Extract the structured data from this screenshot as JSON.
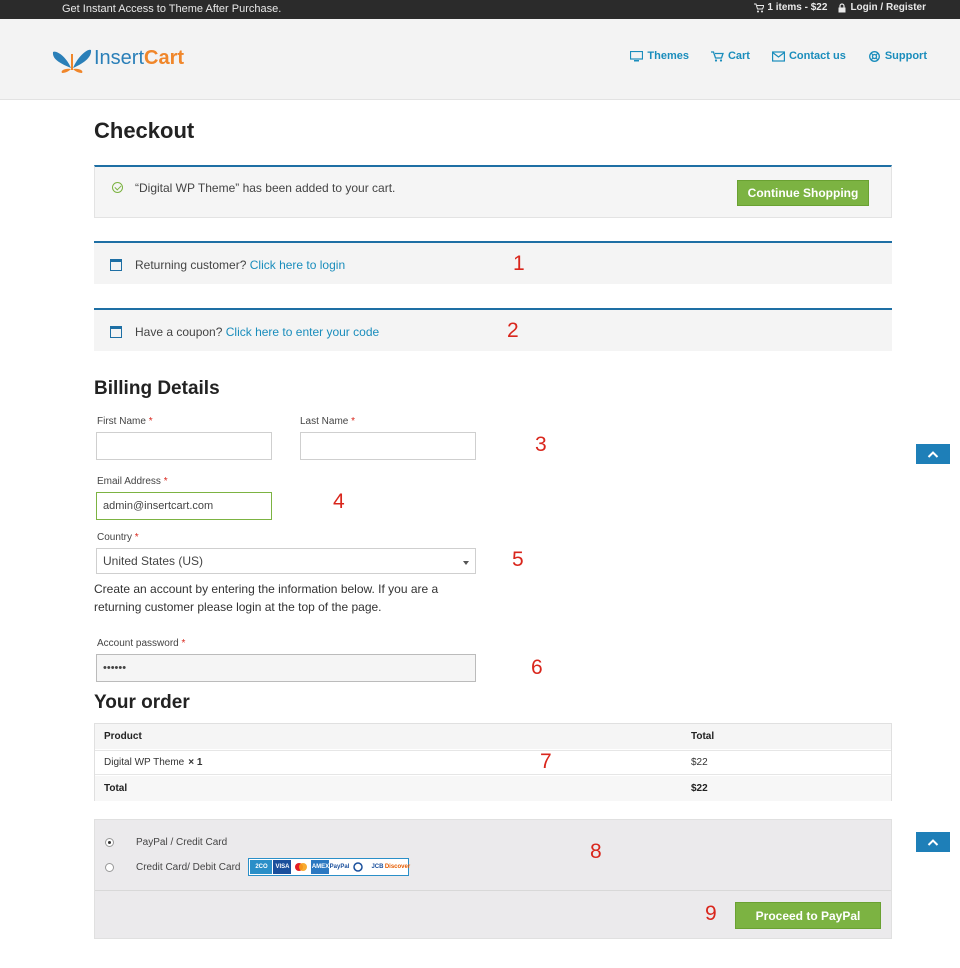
{
  "topbar": {
    "promo": "Get Instant Access to Theme After Purchase.",
    "cart_summary": "1 items - $22",
    "login_register": "Login / Register"
  },
  "brand": {
    "part1": "Insert",
    "part2": "Cart"
  },
  "nav": [
    {
      "label": "Themes",
      "icon": "monitor-icon"
    },
    {
      "label": "Cart",
      "icon": "cart-icon"
    },
    {
      "label": "Contact us",
      "icon": "envelope-icon"
    },
    {
      "label": "Support",
      "icon": "lifebuoy-icon"
    }
  ],
  "page_title": "Checkout",
  "cart_notice": {
    "message": "“Digital WP Theme” has been added to your cart.",
    "button": "Continue Shopping"
  },
  "login_notice": {
    "text": "Returning customer?",
    "link": "Click here to login"
  },
  "coupon_notice": {
    "text": "Have a coupon?",
    "link": "Click here to enter your code"
  },
  "billing": {
    "title": "Billing Details",
    "first_name": {
      "label": "First Name",
      "value": ""
    },
    "last_name": {
      "label": "Last Name",
      "value": ""
    },
    "email": {
      "label": "Email Address",
      "value": "admin@insertcart.com"
    },
    "country": {
      "label": "Country",
      "value": "United States (US)"
    },
    "help": "Create an account by entering the information below. If you are a returning customer please login at the top of the page.",
    "password": {
      "label": "Account password",
      "value": "••••••"
    },
    "required_mark": "*"
  },
  "order": {
    "title": "Your order",
    "headers": [
      "Product",
      "Total"
    ],
    "item": {
      "name": "Digital WP Theme",
      "qty": "× 1",
      "total": "$22"
    },
    "total_label": "Total",
    "total_value": "$22"
  },
  "payment": {
    "options": [
      "PayPal / Credit Card",
      "Credit Card/ Debit Card"
    ],
    "selected_index": 0,
    "card_logos": [
      "2CO",
      "VISA",
      "MC",
      "AMEX",
      "PayPal",
      "Diners",
      "JCB",
      "Discover"
    ],
    "button": "Proceed to PayPal"
  },
  "annotations": [
    "1",
    "2",
    "3",
    "4",
    "5",
    "6",
    "7",
    "8",
    "9"
  ],
  "colors": {
    "accent_blue": "#1e6fa4",
    "link_blue": "#1a8dbc",
    "green": "#7cb342",
    "annotation_red": "#d9261c"
  }
}
